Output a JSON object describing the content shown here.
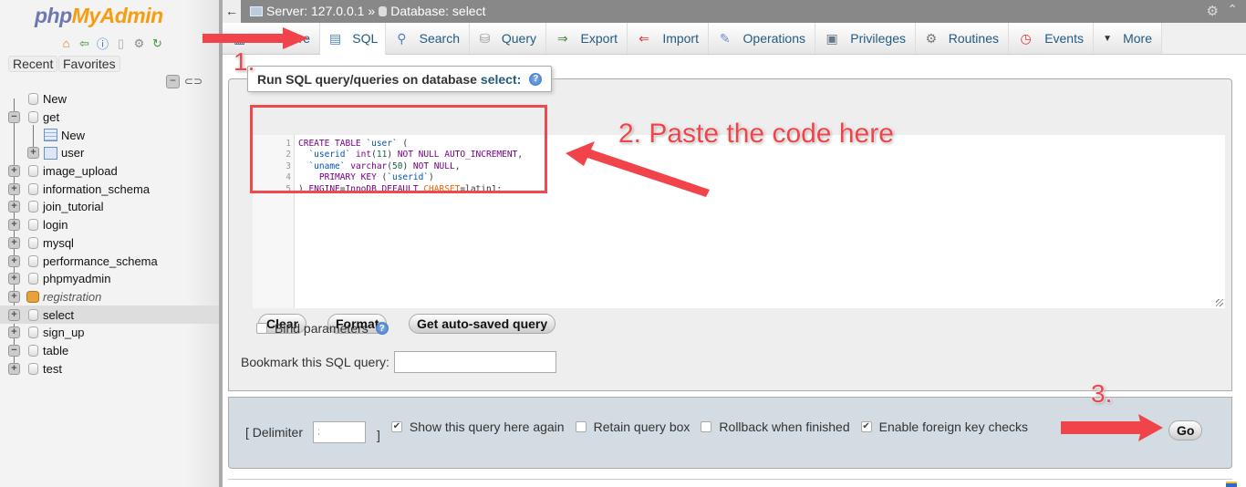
{
  "sidebar": {
    "logo_php": "php",
    "logo_myadmin": "MyAdmin",
    "nav_icons": [
      "home-icon",
      "logout-icon",
      "help-icon",
      "docs-icon",
      "settings-icon",
      "reload-icon"
    ],
    "recent_label": "Recent",
    "favorites_label": "Favorites",
    "tree": [
      {
        "label": "New",
        "level": 0,
        "type": "new-db",
        "expander": "none"
      },
      {
        "label": "get",
        "level": 0,
        "type": "db",
        "expander": "minus"
      },
      {
        "label": "New",
        "level": 1,
        "type": "new-table",
        "expander": "none"
      },
      {
        "label": "user",
        "level": 1,
        "type": "table",
        "expander": "plus"
      },
      {
        "label": "image_upload",
        "level": 0,
        "type": "db",
        "expander": "plus"
      },
      {
        "label": "information_schema",
        "level": 0,
        "type": "db",
        "expander": "plus"
      },
      {
        "label": "join_tutorial",
        "level": 0,
        "type": "db",
        "expander": "plus"
      },
      {
        "label": "login",
        "level": 0,
        "type": "db",
        "expander": "plus"
      },
      {
        "label": "mysql",
        "level": 0,
        "type": "db",
        "expander": "plus"
      },
      {
        "label": "performance_schema",
        "level": 0,
        "type": "db",
        "expander": "plus"
      },
      {
        "label": "phpmyadmin",
        "level": 0,
        "type": "db",
        "expander": "plus"
      },
      {
        "label": "registration",
        "level": 0,
        "type": "db-loading",
        "expander": "plus"
      },
      {
        "label": "select",
        "level": 0,
        "type": "db",
        "expander": "plus",
        "selected": true
      },
      {
        "label": "sign_up",
        "level": 0,
        "type": "db",
        "expander": "plus"
      },
      {
        "label": "table",
        "level": 0,
        "type": "db",
        "expander": "minus"
      },
      {
        "label": "test",
        "level": 0,
        "type": "db",
        "expander": "plus"
      }
    ]
  },
  "topbar": {
    "back": "←",
    "server_label": "Server: 127.0.0.1",
    "separator": "»",
    "database_label": "Database: select"
  },
  "tabs": [
    {
      "label": "Structure",
      "icon": "structure-icon",
      "glyph": "▦"
    },
    {
      "label": "SQL",
      "icon": "sql-icon",
      "glyph": "📜",
      "active": true
    },
    {
      "label": "Search",
      "icon": "search-icon",
      "glyph": "🔍"
    },
    {
      "label": "Query",
      "icon": "query-icon",
      "glyph": "⛁"
    },
    {
      "label": "Export",
      "icon": "export-icon",
      "glyph": "⇒"
    },
    {
      "label": "Import",
      "icon": "import-icon",
      "glyph": "⇐"
    },
    {
      "label": "Operations",
      "icon": "wrench-icon",
      "glyph": "🔧"
    },
    {
      "label": "Privileges",
      "icon": "privileges-icon",
      "glyph": "▣"
    },
    {
      "label": "Routines",
      "icon": "routines-icon",
      "glyph": "⚙"
    },
    {
      "label": "Events",
      "icon": "clock-icon",
      "glyph": "◷"
    },
    {
      "label": "More",
      "icon": "caret-down-icon",
      "glyph": "▼"
    }
  ],
  "sql_panel": {
    "legend_prefix": "Run SQL query/queries on database",
    "legend_db": "select:",
    "code_lines": [
      "CREATE TABLE `user` (",
      "  `userid` int(11) NOT NULL AUTO_INCREMENT,",
      "  `uname` varchar(50) NOT NULL,",
      "    PRIMARY KEY (`userid`)",
      ") ENGINE=InnoDB DEFAULT CHARSET=latin1;"
    ],
    "clear_label": "Clear",
    "format_label": "Format",
    "autosaved_label": "Get auto-saved query",
    "bind_params_label": "Bind parameters",
    "bind_params_checked": false,
    "bookmark_label": "Bookmark this SQL query:",
    "bookmark_value": ""
  },
  "footer": {
    "delimiter_open": "[ Delimiter",
    "delimiter_value": ";",
    "delimiter_close": "]",
    "options": [
      {
        "label": "Show this query here again",
        "checked": true
      },
      {
        "label": "Retain query box",
        "checked": false
      },
      {
        "label": "Rollback when finished",
        "checked": false
      },
      {
        "label": "Enable foreign key checks",
        "checked": true
      }
    ],
    "go_label": "Go"
  },
  "annotations": {
    "step1": "1.",
    "step2": "2. Paste the code here",
    "step3": "3.",
    "color": "#f0444a"
  }
}
